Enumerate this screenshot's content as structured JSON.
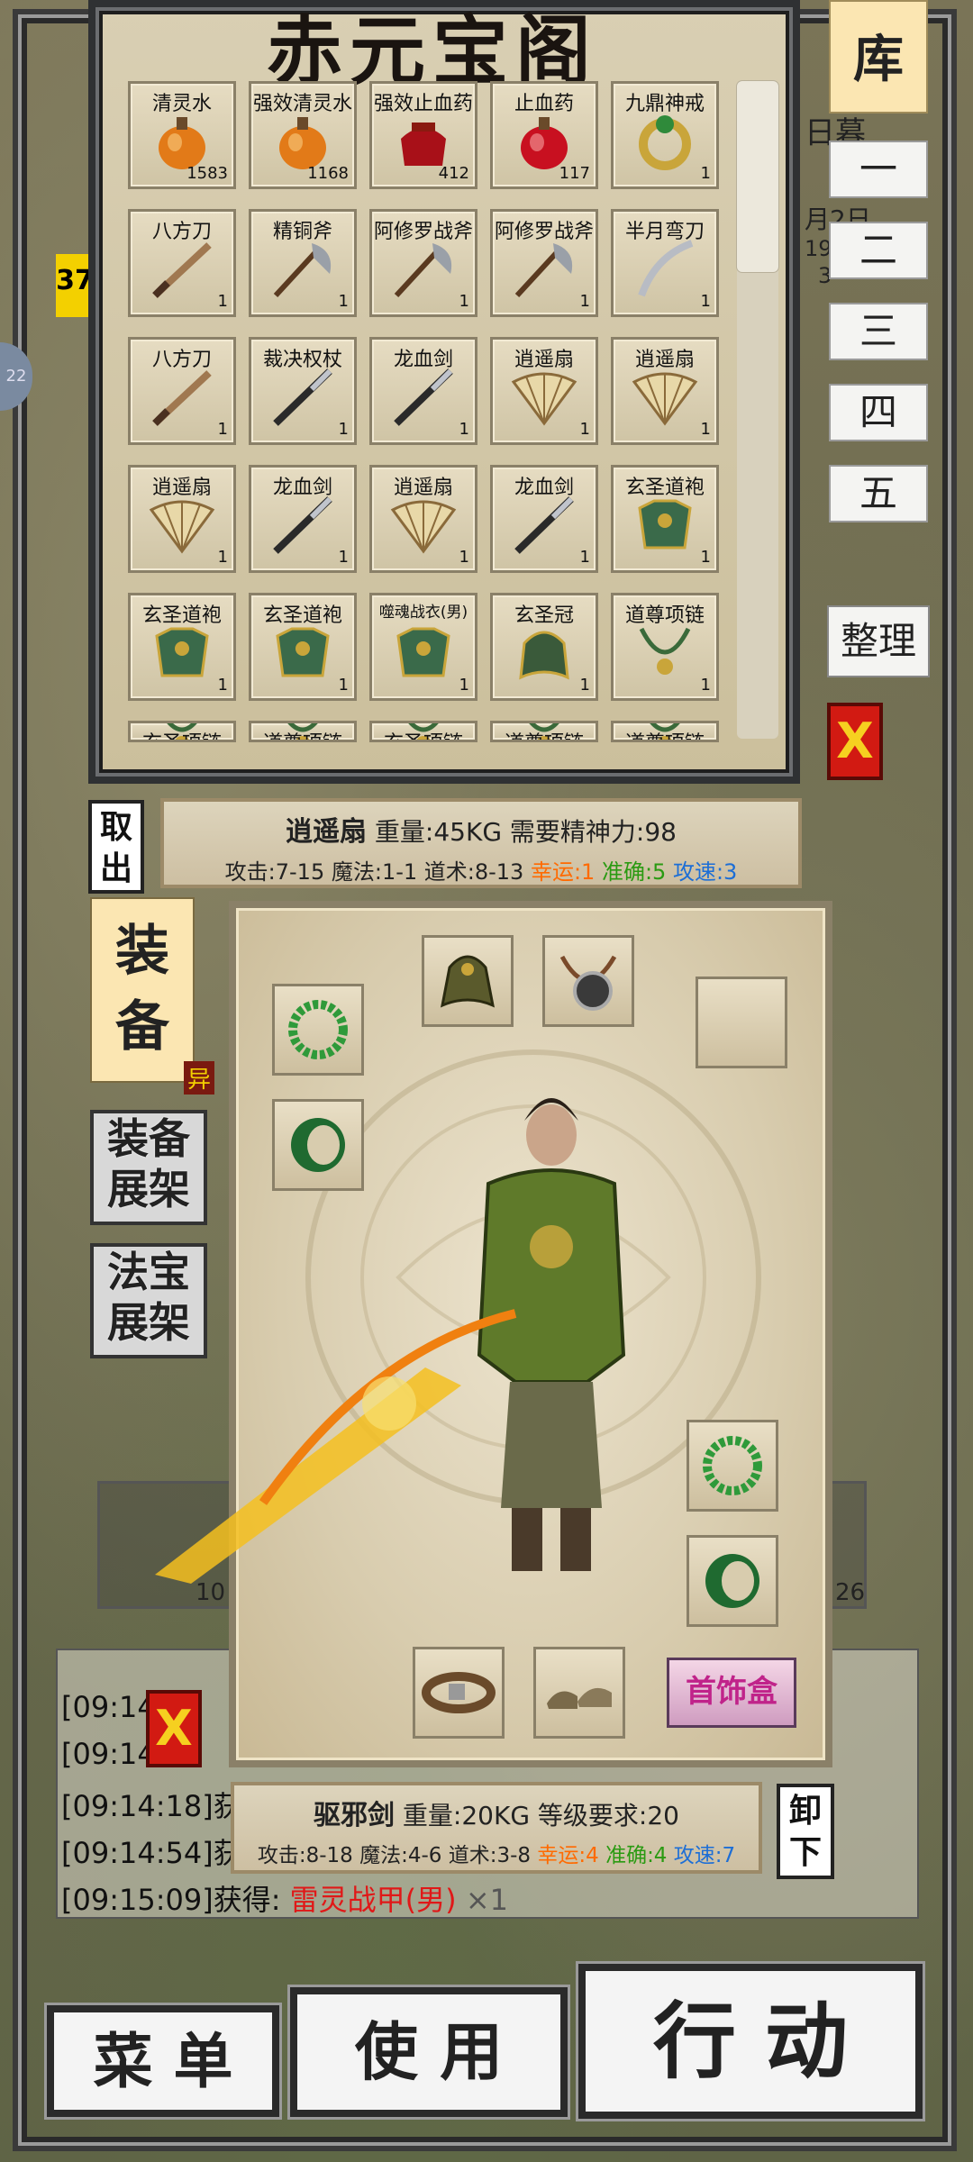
{
  "warehouse": {
    "title": "赤元宝阁",
    "rows": [
      [
        {
          "name": "清灵水",
          "count": "1583",
          "icon": "potion-orange-icon"
        },
        {
          "name": "强效清灵水",
          "count": "1168",
          "icon": "potion-orange-icon"
        },
        {
          "name": "强效止血药",
          "count": "412",
          "icon": "jar-red-icon"
        },
        {
          "name": "止血药",
          "count": "117",
          "icon": "potion-red-icon"
        },
        {
          "name": "九鼎神戒",
          "count": "1",
          "icon": "ring-gold-icon"
        }
      ],
      [
        {
          "name": "八方刀",
          "count": "1",
          "icon": "blade-icon"
        },
        {
          "name": "精铜斧",
          "count": "1",
          "icon": "axe-icon"
        },
        {
          "name": "阿修罗战斧",
          "count": "1",
          "icon": "axe-icon"
        },
        {
          "name": "阿修罗战斧",
          "count": "1",
          "icon": "axe-icon"
        },
        {
          "name": "半月弯刀",
          "count": "1",
          "icon": "curved-blade-icon"
        }
      ],
      [
        {
          "name": "八方刀",
          "count": "1",
          "icon": "blade-icon"
        },
        {
          "name": "裁决权杖",
          "count": "1",
          "icon": "sword-icon"
        },
        {
          "name": "龙血剑",
          "count": "1",
          "icon": "sword-icon"
        },
        {
          "name": "逍遥扇",
          "count": "1",
          "icon": "fan-icon"
        },
        {
          "name": "逍遥扇",
          "count": "1",
          "icon": "fan-icon"
        }
      ],
      [
        {
          "name": "逍遥扇",
          "count": "1",
          "icon": "fan-icon"
        },
        {
          "name": "龙血剑",
          "count": "1",
          "icon": "sword-icon"
        },
        {
          "name": "逍遥扇",
          "count": "1",
          "icon": "fan-icon"
        },
        {
          "name": "龙血剑",
          "count": "1",
          "icon": "sword-icon"
        },
        {
          "name": "玄圣道袍",
          "count": "1",
          "icon": "armor-icon"
        }
      ],
      [
        {
          "name": "玄圣道袍",
          "count": "1",
          "icon": "armor-icon"
        },
        {
          "name": "玄圣道袍",
          "count": "1",
          "icon": "armor-icon"
        },
        {
          "name": "噬魂战衣(男)",
          "count": "1",
          "icon": "armor-icon"
        },
        {
          "name": "玄圣冠",
          "count": "1",
          "icon": "helmet-icon"
        },
        {
          "name": "道尊项链",
          "count": "1",
          "icon": "necklace-icon"
        }
      ],
      [
        {
          "name": "玄圣项链",
          "count": "",
          "icon": "necklace-icon"
        },
        {
          "name": "道尊项链",
          "count": "",
          "icon": "necklace-icon"
        },
        {
          "name": "玄圣项链",
          "count": "",
          "icon": "necklace-icon"
        },
        {
          "name": "道尊项链",
          "count": "",
          "icon": "necklace-icon"
        },
        {
          "name": "道尊项链",
          "count": "",
          "icon": "necklace-icon"
        }
      ]
    ]
  },
  "side_tabs": {
    "ku": "库",
    "tabs": [
      "一",
      "二",
      "三",
      "四",
      "五"
    ],
    "sort": "整理",
    "close": "X"
  },
  "selected_item": {
    "name": "逍遥扇",
    "line1_rest": " 重量:45KG 需要精神力:98",
    "stats": "攻击:7-15 魔法:1-1 道术:8-13 ",
    "luck": "幸运:1",
    "acc": "准确:5",
    "spd": "攻速:3"
  },
  "take_out_label": "取出",
  "equip_tab": "装备",
  "shelf_equip": "装备展架",
  "shelf_magic": "法宝展架",
  "equipped_item": {
    "name": "驱邪剑",
    "line1_rest": " 重量:20KG 等级要求:20",
    "stats": "攻击:8-18 魔法:4-6 道术:3-8 ",
    "luck": "幸运:4",
    "acc": "准确:4",
    "spd": "攻速:7"
  },
  "jewel_box": "首饰盒",
  "unequip_label": "卸下",
  "log": {
    "lines": [
      "[09:14",
      "[09:14",
      "[09:14:18]获",
      "[09:14:54]获"
    ],
    "last_prefix": "[09:15:09]获得: ",
    "last_item": "雷灵战甲(男)",
    "last_suffix": " ×1",
    "close": "X"
  },
  "bottom": {
    "menu": "菜 单",
    "use": "使 用",
    "action": "行 动"
  },
  "partials": {
    "left_num": "37",
    "side_hint": "22",
    "ground_left": "10",
    "ground_right": "26",
    "top_right": [
      "日暮",
      "月2日",
      "19",
      "3"
    ],
    "mid_left": "异"
  },
  "colors": {
    "luck": "#ff6a00",
    "accuracy": "#2a9a12",
    "speed": "#1c6ed6",
    "close_red": "#d21a12"
  }
}
